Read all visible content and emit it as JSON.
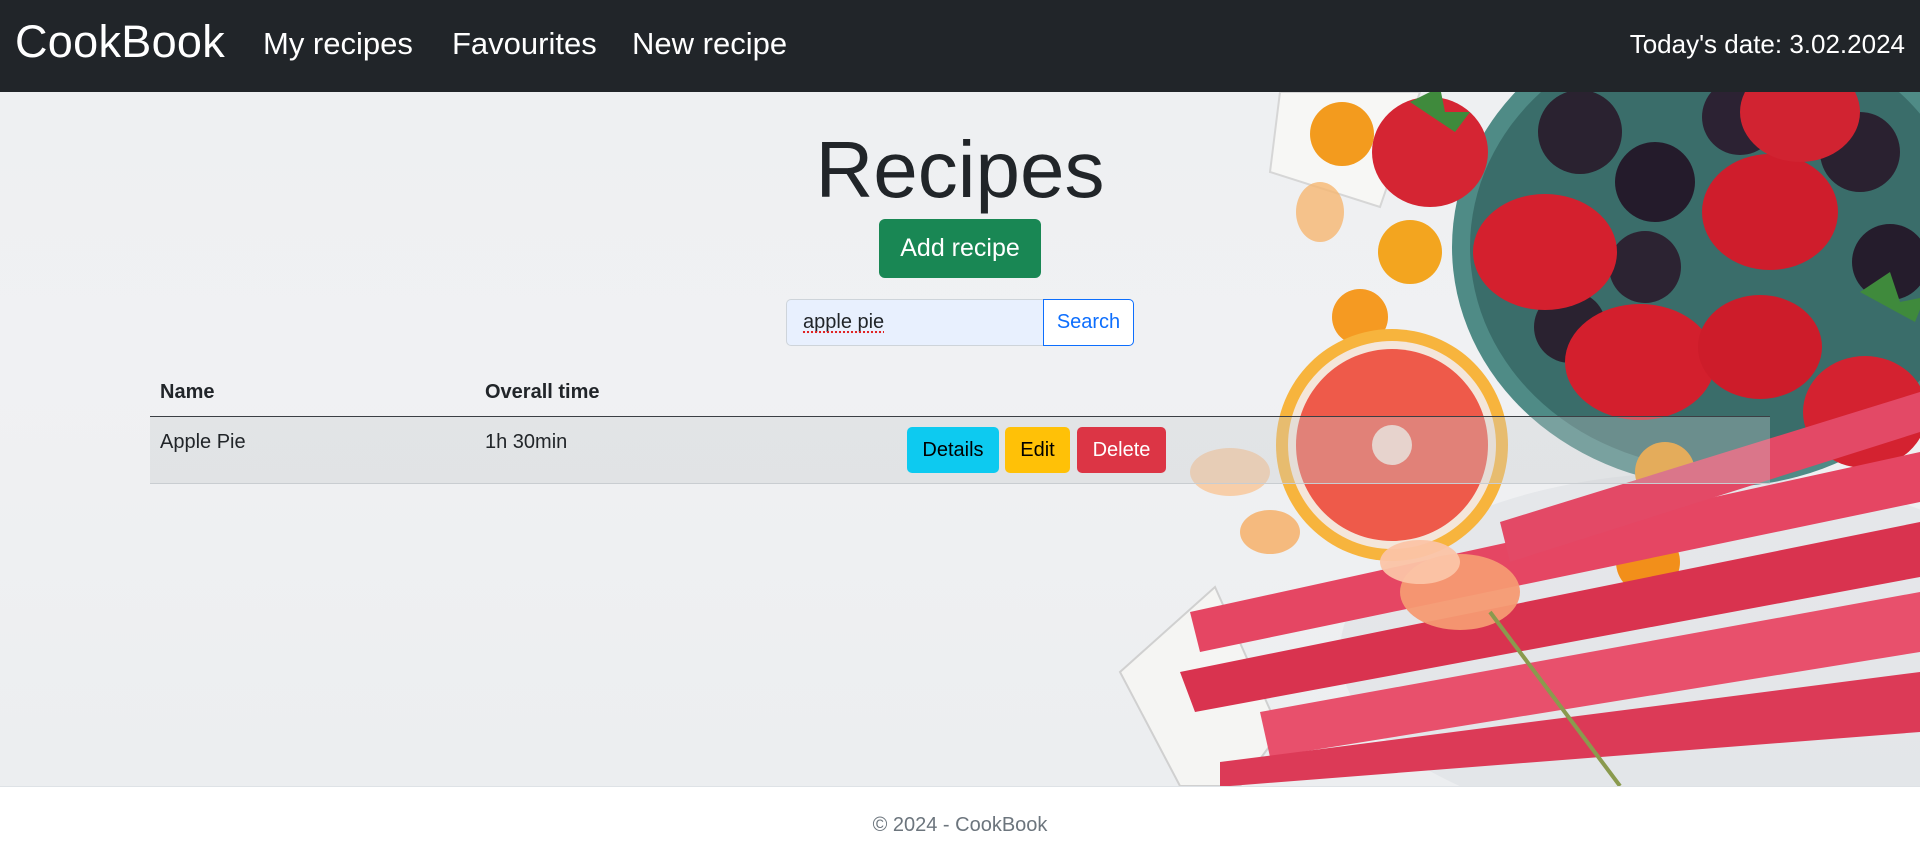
{
  "navbar": {
    "brand": "CookBook",
    "links": [
      "My recipes",
      "Favourites",
      "New recipe"
    ],
    "date_text": "Today's date: 3.02.2024"
  },
  "main": {
    "title": "Recipes",
    "add_button": "Add recipe",
    "search": {
      "value": "apple pie",
      "button": "Search"
    },
    "table": {
      "headers": [
        "Name",
        "Overall time"
      ],
      "rows": [
        {
          "name": "Apple Pie",
          "time": "1h 30min",
          "actions": [
            "Details",
            "Edit",
            "Delete"
          ]
        }
      ]
    }
  },
  "footer": {
    "text": "© 2024 - CookBook"
  },
  "colors": {
    "navbar": "#212529",
    "add": "#198754",
    "search": "#0d6efd",
    "details": "#0dcaf0",
    "edit": "#ffc107",
    "delete": "#dc3545"
  }
}
